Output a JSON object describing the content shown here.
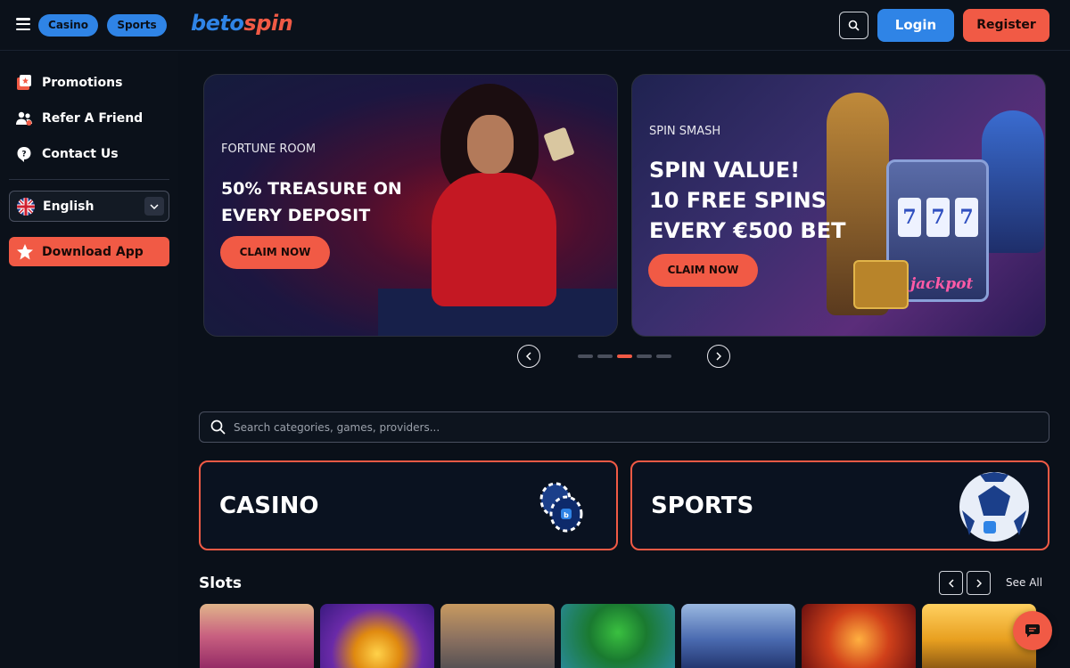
{
  "header": {
    "nav_pills": {
      "casino": "Casino",
      "sports": "Sports"
    },
    "logo": {
      "part1": "beto",
      "part2": "spin"
    },
    "login_label": "Login",
    "register_label": "Register"
  },
  "sidebar": {
    "items": [
      {
        "label": "Promotions",
        "icon": "promotions-icon"
      },
      {
        "label": "Refer A Friend",
        "icon": "refer-friend-icon"
      },
      {
        "label": "Contact Us",
        "icon": "help-icon"
      }
    ],
    "language": "English",
    "download_label": "Download App"
  },
  "banners": [
    {
      "eyebrow": "FORTUNE ROOM",
      "headline": "50% TREASURE ON EVERY DEPOSIT",
      "cta": "CLAIM NOW"
    },
    {
      "eyebrow": "SPIN SMASH",
      "headline_lines": [
        "SPIN VALUE!",
        "10 FREE SPINS",
        "EVERY €500 BET"
      ],
      "cta": "CLAIM NOW",
      "art_text": "jackpot"
    }
  ],
  "carousel": {
    "slide_count": 5,
    "active_index": 2
  },
  "search": {
    "placeholder": "Search categories, games, providers..."
  },
  "categories": {
    "casino": "CASINO",
    "sports": "SPORTS"
  },
  "slots": {
    "title": "Slots",
    "see_all": "See All"
  },
  "colors": {
    "accent_blue": "#2f84e6",
    "accent_red": "#f15a45",
    "background": "#0a1019"
  }
}
